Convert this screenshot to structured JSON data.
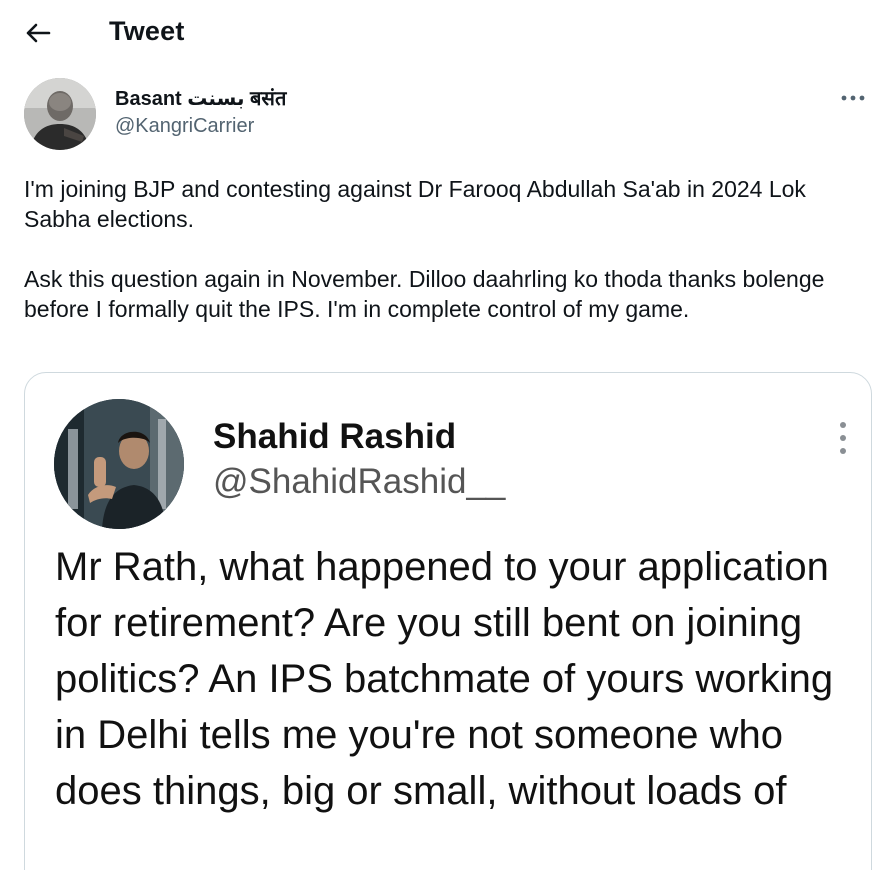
{
  "header": {
    "title": "Tweet",
    "back_icon": "arrow-left-icon"
  },
  "tweet": {
    "author": {
      "name": "Basant بسنت बसंत",
      "handle": "@KangriCarrier"
    },
    "more_icon": "more-horizontal-icon",
    "paragraphs": [
      "I'm joining BJP and contesting against Dr Farooq Abdullah Sa'ab in 2024 Lok Sabha elections.",
      "Ask this question again in November. Dilloo daahrling ko thoda thanks bolenge before I formally quit the IPS. I'm in complete control of my game."
    ]
  },
  "quoted": {
    "author": {
      "name": "Shahid Rashid",
      "handle": "@ShahidRashid__"
    },
    "more_icon": "more-vertical-icon",
    "text": "Mr Rath, what happened to your application for retirement? Are you still bent on joining politics? An IPS batchmate of yours working in Delhi tells me you're not someone who does things, big or small, without loads of"
  },
  "colors": {
    "text_primary": "#0f1419",
    "text_secondary": "#536471",
    "border": "#cfd9de"
  }
}
